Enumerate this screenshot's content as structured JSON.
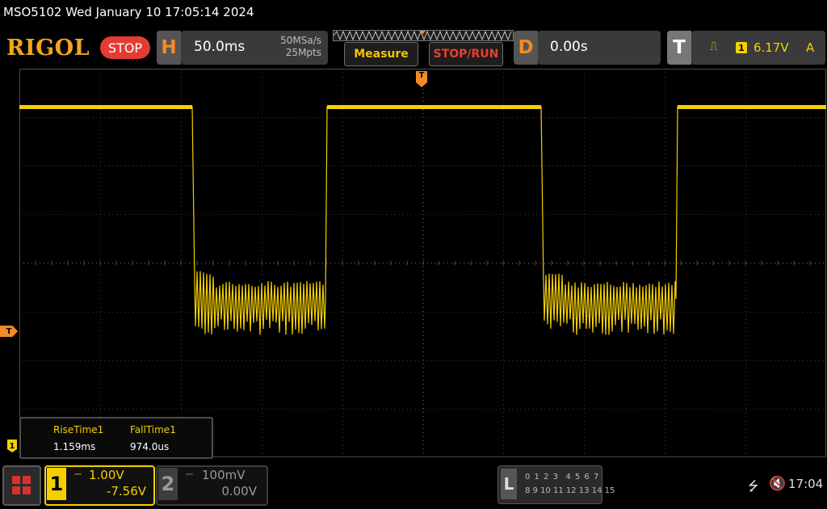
{
  "title": "MSO5102  Wed January 10 17:05:14 2024",
  "toolbar": {
    "logo": "RIGOL",
    "run_state": "STOP",
    "horizontal": {
      "label": "H",
      "timebase": "50.0ms",
      "sample_rate": "50MSa/s",
      "memory_depth": "25Mpts"
    },
    "measure_label": "Measure",
    "stoprun_label": "STOP/RUN",
    "delay": {
      "label": "D",
      "value": "0.00s"
    },
    "trigger": {
      "label": "T",
      "edge_icon": "rising-edge-icon",
      "source": "1",
      "level": "6.17V",
      "mode": "A"
    }
  },
  "markers": {
    "ch1_ground": "1",
    "trigger_level": "T",
    "trigger_position": "T"
  },
  "measurements": {
    "labels": [
      "RiseTime1",
      "FallTime1"
    ],
    "values": [
      "1.159ms",
      "974.0us"
    ]
  },
  "channels": {
    "ch1": {
      "number": "1",
      "coupling": "⎓",
      "scale": "1.00V",
      "offset": "-7.56V",
      "color": "#f5d000"
    },
    "ch2": {
      "number": "2",
      "coupling": "⎓",
      "scale": "100mV",
      "offset": "0.00V",
      "color": "#8c8c8c"
    }
  },
  "logic": {
    "label": "L",
    "row1": "0 1 2 3  4 5 6 7",
    "row2": "8 9 10 11 12 13 14 15"
  },
  "status": {
    "usb_icon": "usb-icon",
    "speaker_icon": "speaker-muted-icon",
    "clock": "17:04"
  },
  "colors": {
    "accent": "#f58a23",
    "trace": "#f5d000",
    "stop": "#e43c35"
  }
}
